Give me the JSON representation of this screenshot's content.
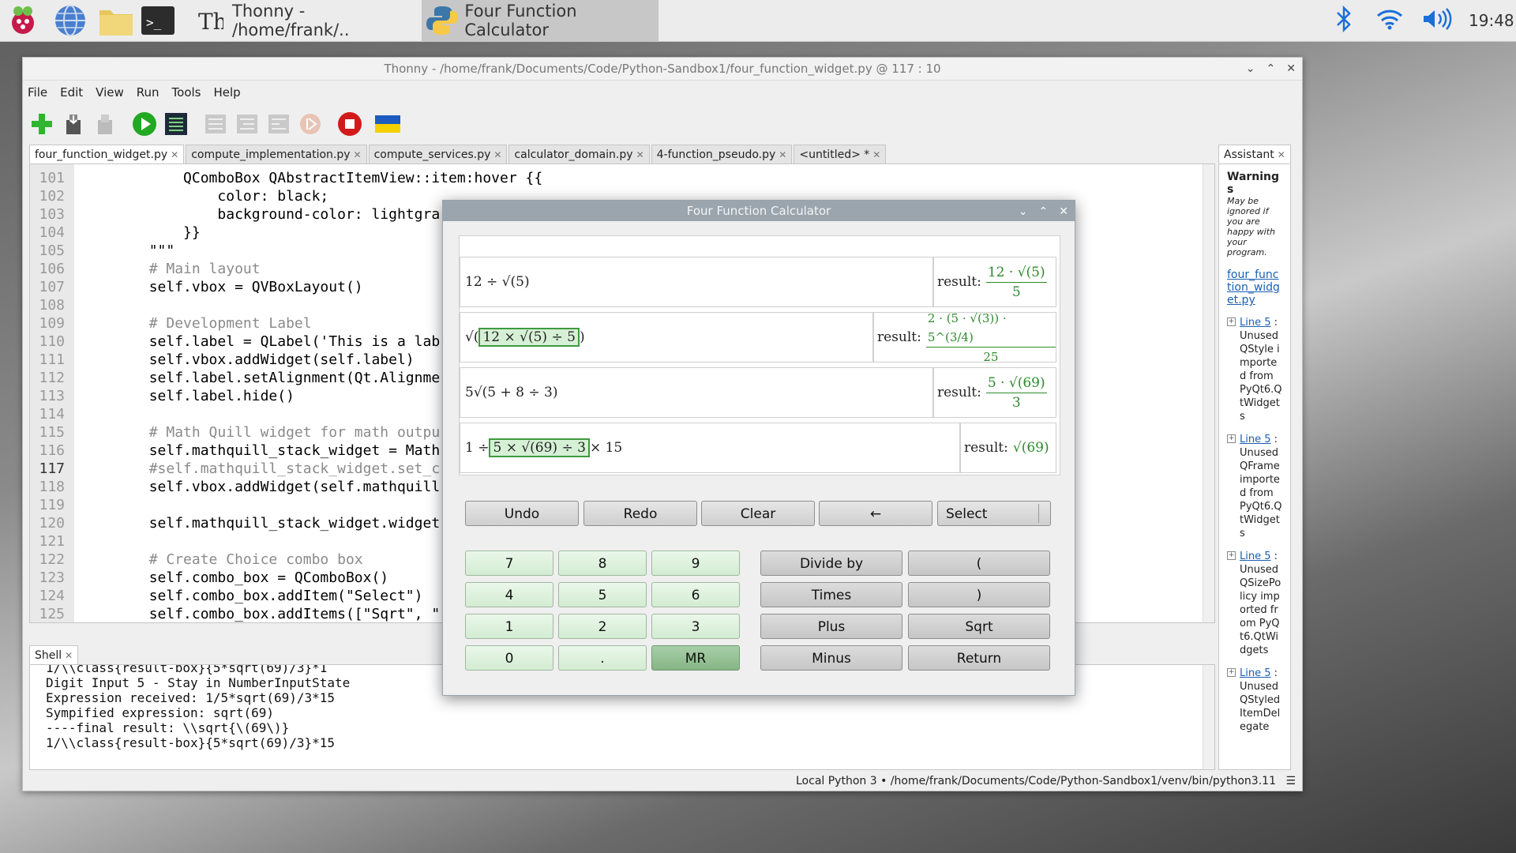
{
  "taskbar": {
    "thonny_task": "Thonny  -  /home/frank/..",
    "calc_task": "Four Function Calculator",
    "clock": "19:48"
  },
  "thonny": {
    "title": "Thonny  -  /home/frank/Documents/Code/Python-Sandbox1/four_function_widget.py  @  117 : 10",
    "menu": [
      "File",
      "Edit",
      "View",
      "Run",
      "Tools",
      "Help"
    ],
    "tabs": [
      "four_function_widget.py",
      "compute_implementation.py",
      "compute_services.py",
      "calculator_domain.py",
      "4-function_pseudo.py",
      "<untitled> *"
    ],
    "line_numbers": [
      "101",
      "102",
      "103",
      "104",
      "105",
      "106",
      "107",
      "108",
      "109",
      "110",
      "111",
      "112",
      "113",
      "114",
      "115",
      "116",
      "117",
      "118",
      "119",
      "120",
      "121",
      "122",
      "123",
      "124",
      "125"
    ],
    "code_lines": [
      "            QComboBox QAbstractItemView::item:hover {{",
      "                color: black;",
      "                background-color: lightgra",
      "            }}",
      "        \"\"\"",
      "        # Main layout",
      "        self.vbox = QVBoxLayout()",
      "",
      "        # Development Label",
      "        self.label = QLabel('This is a lab",
      "        self.vbox.addWidget(self.label)",
      "        self.label.setAlignment(Qt.Alignme",
      "        self.label.hide()",
      "",
      "        # Math Quill widget for math outpu",
      "        self.mathquill_stack_widget = Math",
      "        #self.mathquill_stack_widget.set_c",
      "        self.vbox.addWidget(self.mathquill",
      "",
      "        self.mathquill_stack_widget.widget",
      "",
      "        # Create Choice combo box",
      "        self.combo_box = QComboBox()",
      "        self.combo_box.addItem(\"Select\")",
      "        self.combo_box.addItems([\"Sqrt\", \""
    ],
    "shell_tab": "Shell",
    "shell_lines": [
      "1/\\\\class{result-box}{5*sqrt(69)/3}*1",
      "Digit Input 5 - Stay in NumberInputState",
      "Expression received: 1/5*sqrt(69)/3*15",
      "Sympified expression: sqrt(69)",
      "----final result: \\\\sqrt{\\(69\\)}",
      "1/\\\\class{result-box}{5*sqrt(69)/3}*15"
    ],
    "status": "Local Python 3  •  /home/frank/Documents/Code/Python-Sandbox1/venv/bin/python3.11",
    "assistant": {
      "tab": "Assistant",
      "heading": "Warnings",
      "note": "May be ignored if you are happy with your program.",
      "file_link": "four_function_widget.py",
      "items": [
        {
          "link": "Line 5",
          "text": ": Unused QStyle imported from PyQt6.QtWidgets"
        },
        {
          "link": "Line 5",
          "text": ": Unused QFrame imported from PyQt6.QtWidgets"
        },
        {
          "link": "Line 5",
          "text": ": Unused QSizePolicy imported from PyQt6.QtWidgets"
        },
        {
          "link": "Line 5",
          "text": ": Unused QStyledItemDelegate"
        }
      ]
    }
  },
  "calculator": {
    "title": "Four Function Calculator",
    "rows": [
      {
        "expr": "12 ÷ √(5)",
        "result_label": "result:",
        "res_num": "12 · √(5)",
        "res_den": "5"
      },
      {
        "expr_pre": "√(",
        "expr_hl": "12 × √(5)  ÷ 5",
        "expr_post": ")",
        "result_label": "result:",
        "res_num": "2 · (5 · √(3)) · 5^(3/4)",
        "res_den": "25"
      },
      {
        "expr": "5√(5 + 8 ÷ 3)",
        "result_label": "result:",
        "res_num": "5 · √(69)",
        "res_den": "3"
      },
      {
        "expr_pre": "1 ÷ ",
        "expr_hl": "5 × √(69)  ÷ 3",
        "expr_post": " × 15",
        "result_label": "result:",
        "res_plain": "√(69)"
      }
    ],
    "top_buttons": [
      "Undo",
      "Redo",
      "Clear",
      "←",
      "Select"
    ],
    "digits": [
      "7",
      "8",
      "9",
      "4",
      "5",
      "6",
      "1",
      "2",
      "3",
      "0",
      ".",
      "MR"
    ],
    "ops": [
      "Divide by",
      "(",
      "Times",
      ")",
      "Plus",
      "Sqrt",
      "Minus",
      "Return"
    ]
  },
  "colors": {
    "result_green": "#2d8a2d",
    "highlight_border": "#3f9a3f",
    "calc_title": "#9aa5ae"
  }
}
